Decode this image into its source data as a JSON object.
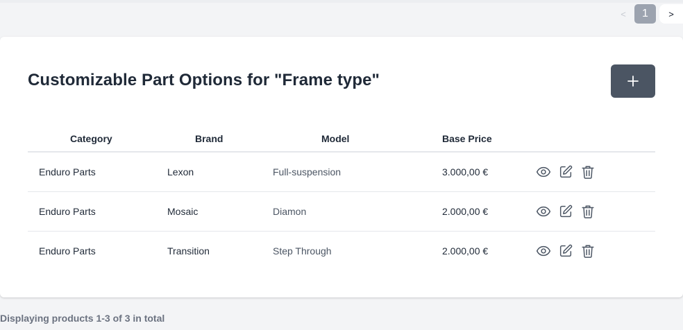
{
  "pagination": {
    "prev": "<",
    "current": "1",
    "next": ">"
  },
  "card": {
    "title": "Customizable Part Options for \"Frame type\""
  },
  "table": {
    "headers": [
      "Category",
      "Brand",
      "Model",
      "Base Price"
    ],
    "rows": [
      {
        "category": "Enduro Parts",
        "brand": "Lexon",
        "model": "Full-suspension",
        "price": "3.000,00 €"
      },
      {
        "category": "Enduro Parts",
        "brand": "Mosaic",
        "model": "Diamon",
        "price": "2.000,00 €"
      },
      {
        "category": "Enduro Parts",
        "brand": "Transition",
        "model": "Step Through",
        "price": "2.000,00 €"
      }
    ],
    "row_actions": [
      "eye-icon",
      "edit-icon",
      "trash-icon"
    ]
  },
  "footer": {
    "text": "Displaying products 1-3 of 3 in total"
  },
  "colors": {
    "add_button": "#4b5563",
    "page_active": "#9ca3af",
    "background": "#f3f4f6"
  }
}
